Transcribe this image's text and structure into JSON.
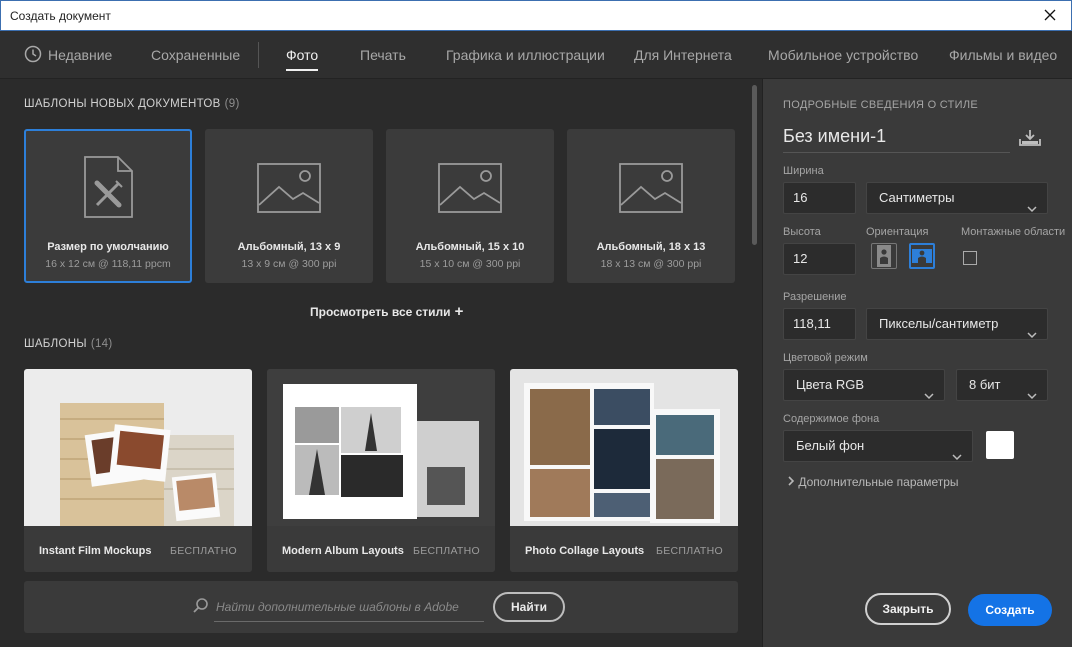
{
  "window": {
    "title": "Создать документ",
    "close_icon": "close-icon"
  },
  "nav": {
    "recent": "Недавние",
    "saved": "Сохраненные",
    "photo": "Фото",
    "print": "Печать",
    "art": "Графика и иллюстрации",
    "web": "Для Интернета",
    "mobile": "Мобильное устройство",
    "film": "Фильмы и видео"
  },
  "presets_section": {
    "title": "ШАБЛОНЫ НОВЫХ ДОКУМЕНТОВ",
    "count": "(9)"
  },
  "presets": [
    {
      "name": "Размер по умолчанию",
      "dims": "16 x 12 см @ 118,11 ppcm",
      "icon": "document-brush-icon",
      "selected": true
    },
    {
      "name": "Альбомный, 13 x 9",
      "dims": "13 x 9 см @ 300 ppi",
      "icon": "image-icon",
      "selected": false
    },
    {
      "name": "Альбомный, 15 x 10",
      "dims": "15 x 10 см @ 300 ppi",
      "icon": "image-icon",
      "selected": false
    },
    {
      "name": "Альбомный, 18 x 13",
      "dims": "18 x 13 см @ 300 ppi",
      "icon": "image-icon",
      "selected": false
    }
  ],
  "view_all": {
    "label": "Просмотреть все стили",
    "icon": "plus-icon"
  },
  "templates_section": {
    "title": "ШАБЛОНЫ",
    "count": "(14)"
  },
  "templates": [
    {
      "name": "Instant Film Mockups",
      "badge": "БЕСПЛАТНО"
    },
    {
      "name": "Modern Album Layouts",
      "badge": "БЕСПЛАТНО"
    },
    {
      "name": "Photo Collage Layouts",
      "badge": "БЕСПЛАТНО"
    }
  ],
  "search": {
    "placeholder": "Найти дополнительные шаблоны в Adobe",
    "button": "Найти",
    "icon": "search-icon"
  },
  "details": {
    "header": "ПОДРОБНЫЕ СВЕДЕНИЯ О СТИЛЕ",
    "doc_name": "Без имени-1",
    "save_icon": "save-preset-icon",
    "width_label": "Ширина",
    "width_value": "16",
    "width_unit": "Сантиметры",
    "height_label": "Высота",
    "height_value": "12",
    "orientation_label": "Ориентация",
    "artboards_label": "Монтажные области",
    "resolution_label": "Разрешение",
    "resolution_value": "118,11",
    "resolution_unit": "Пикселы/сантиметр",
    "color_mode_label": "Цветовой режим",
    "color_mode": "Цвета RGB",
    "bit_depth": "8 бит",
    "bg_label": "Содержимое фона",
    "bg_value": "Белый фон",
    "bg_color": "#ffffff",
    "more_options": "Дополнительные параметры"
  },
  "buttons": {
    "close": "Закрыть",
    "create": "Создать"
  },
  "colors": {
    "accent": "#1473e6",
    "selection": "#2d7fd9"
  }
}
